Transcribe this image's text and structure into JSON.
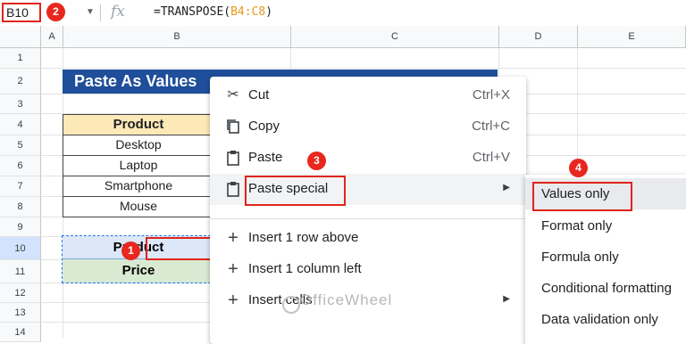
{
  "formula_bar": {
    "name_box": "B10",
    "fx": "fx",
    "formula_prefix": "=TRANSPOSE(",
    "formula_ref": "B4:C8",
    "formula_suffix": ")"
  },
  "columns": [
    "A",
    "B",
    "C",
    "D",
    "E"
  ],
  "rows": [
    "1",
    "2",
    "3",
    "4",
    "5",
    "6",
    "7",
    "8",
    "9",
    "10",
    "11",
    "12",
    "13",
    "14"
  ],
  "sheet": {
    "title": "Paste As Values",
    "table_header": "Product",
    "products": [
      "Desktop",
      "Laptop",
      "Smartphone",
      "Mouse"
    ],
    "selected_row_1": "Product",
    "selected_row_2": "Price"
  },
  "context_menu": {
    "items": [
      {
        "label": "Cut",
        "shortcut": "Ctrl+X",
        "icon": "scissors-icon"
      },
      {
        "label": "Copy",
        "shortcut": "Ctrl+C",
        "icon": "copy-icon"
      },
      {
        "label": "Paste",
        "shortcut": "Ctrl+V",
        "icon": "clipboard-icon"
      },
      {
        "label": "Paste special",
        "shortcut": "",
        "icon": "clipboard-icon",
        "has_submenu": true
      },
      {
        "label": "Insert 1 row above",
        "icon": "plus-icon"
      },
      {
        "label": "Insert 1 column left",
        "icon": "plus-icon"
      },
      {
        "label": "Insert cells",
        "icon": "plus-icon",
        "has_submenu": true
      }
    ]
  },
  "submenu": {
    "items": [
      "Values only",
      "Format only",
      "Formula only",
      "Conditional formatting",
      "Data validation only"
    ]
  },
  "badges": [
    "1",
    "2",
    "3",
    "4"
  ],
  "watermark": "OfficeWheel",
  "colors": {
    "badge": "#e8281f",
    "highlight": "#e0241b",
    "title_bg": "#1f4e9a",
    "header_bg": "#fde9b8",
    "price_bg": "#d9ead3",
    "selection": "#1a73e8"
  }
}
